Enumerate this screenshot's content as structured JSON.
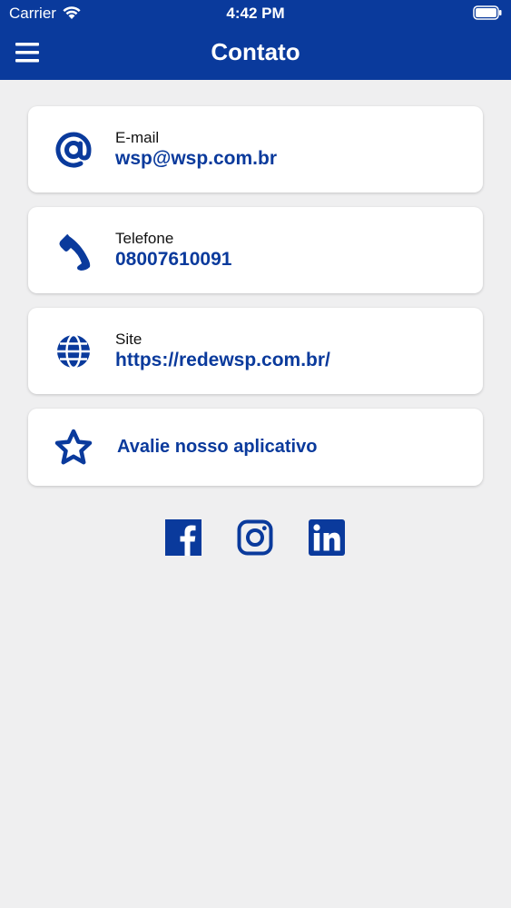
{
  "status_bar": {
    "carrier": "Carrier",
    "time": "4:42 PM"
  },
  "header": {
    "title": "Contato",
    "menu_icon": "hamburger-menu-icon"
  },
  "contacts": [
    {
      "icon": "at-sign-icon",
      "label": "E-mail",
      "value": "wsp@wsp.com.br"
    },
    {
      "icon": "phone-icon",
      "label": "Telefone",
      "value": "08007610091"
    },
    {
      "icon": "globe-icon",
      "label": "Site",
      "value": "https://redewsp.com.br/"
    }
  ],
  "rate_app": {
    "icon": "star-icon",
    "label": "Avalie nosso aplicativo"
  },
  "social": [
    "facebook-icon",
    "instagram-icon",
    "linkedin-icon"
  ],
  "colors": {
    "brand": "#0a3a9c",
    "background": "#efeff0",
    "card": "#ffffff"
  }
}
